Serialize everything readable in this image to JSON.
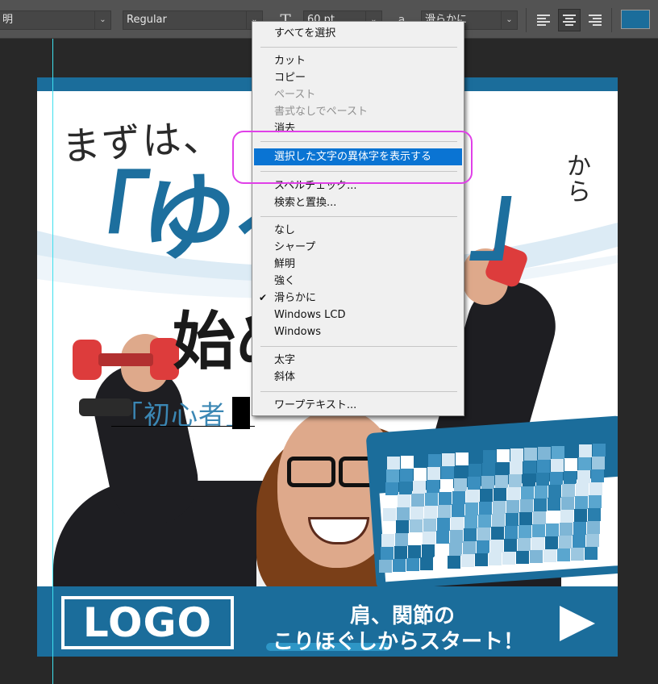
{
  "toolbar": {
    "font_family": "明",
    "font_style": "Regular",
    "font_size": "60 pt",
    "antialias_icon_text": "a",
    "antialias": "滑らかに",
    "text_color": "#1b6d9b"
  },
  "canvas": {
    "headline_top": "まずは、",
    "headline_big_open": "「ゆる",
    "headline_big_close": "」",
    "headline_kara": "から",
    "headline_hajime": "始め",
    "editing_text": "「初心者」",
    "logo": "LOGO",
    "tagline_line1": "肩、関節の",
    "tagline_line2": "こりほぐしからスタート！",
    "brand_color": "#1b6d9b"
  },
  "context_menu": {
    "items": [
      {
        "label": "すべてを選択",
        "enabled": true
      },
      {
        "label": "カット",
        "enabled": true
      },
      {
        "label": "コピー",
        "enabled": true
      },
      {
        "label": "ペースト",
        "enabled": false
      },
      {
        "label": "書式なしでペースト",
        "enabled": false
      },
      {
        "label": "消去",
        "enabled": true
      },
      {
        "label": "選択した文字の異体字を表示する",
        "enabled": true,
        "highlighted": true
      },
      {
        "label": "スペルチェック...",
        "enabled": true
      },
      {
        "label": "検索と置換...",
        "enabled": true
      },
      {
        "label": "なし",
        "enabled": true
      },
      {
        "label": "シャープ",
        "enabled": true
      },
      {
        "label": "鮮明",
        "enabled": true
      },
      {
        "label": "強く",
        "enabled": true
      },
      {
        "label": "滑らかに",
        "enabled": true,
        "checked": true
      },
      {
        "label": "Windows LCD",
        "enabled": true
      },
      {
        "label": "Windows",
        "enabled": true
      },
      {
        "label": "太字",
        "enabled": true
      },
      {
        "label": "斜体",
        "enabled": true
      },
      {
        "label": "ワープテキスト...",
        "enabled": true
      }
    ],
    "check_mark": "✔",
    "highlight_ring_color": "#e040e8"
  }
}
